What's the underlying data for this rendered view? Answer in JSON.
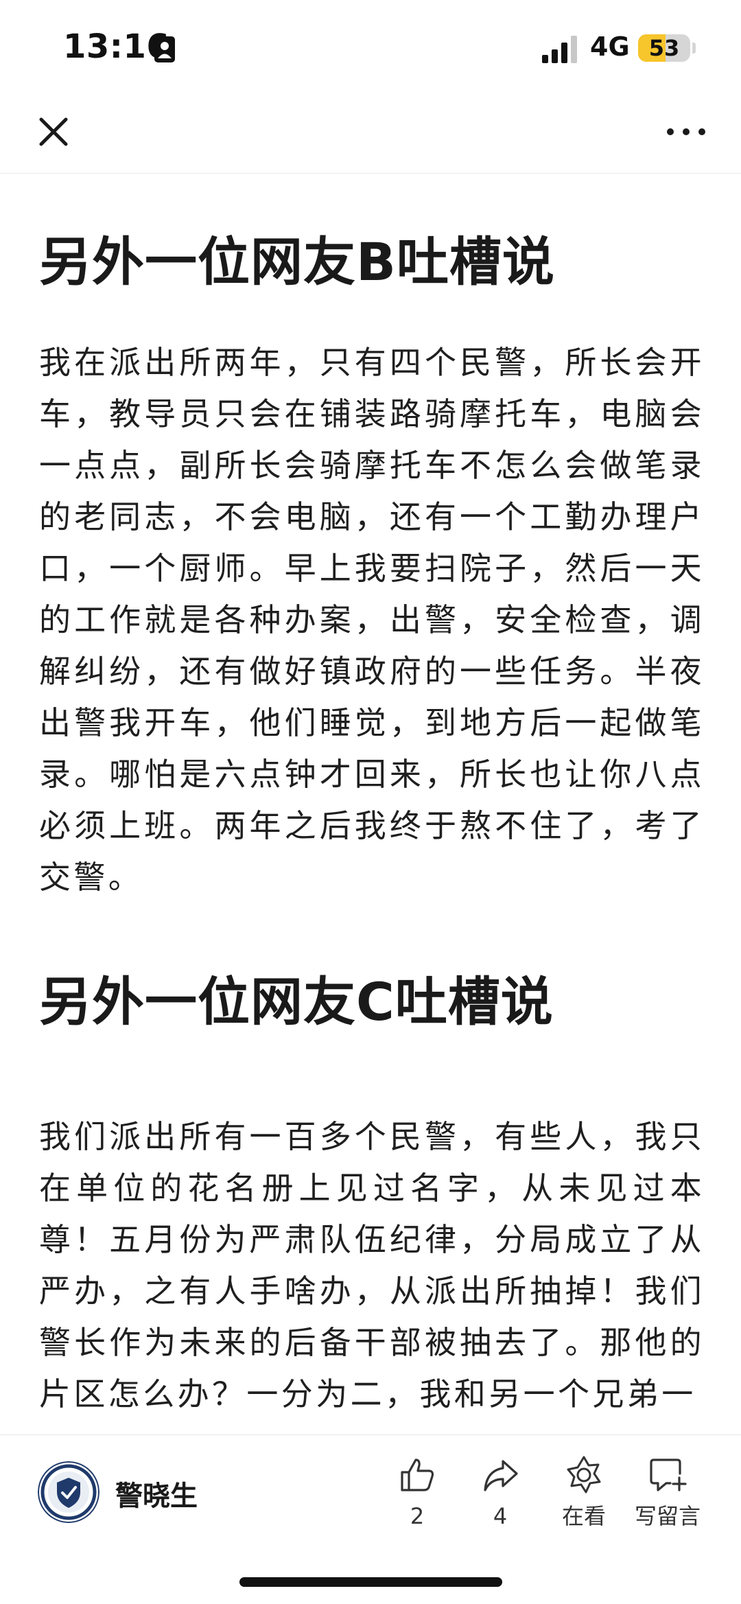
{
  "status_bar": {
    "time": "13:16",
    "network": "4G",
    "battery_percent": 53
  },
  "nav": {
    "close_icon": "close-icon",
    "more_icon": "more-icon"
  },
  "article": {
    "sections": [
      {
        "heading": "另外一位网友B吐槽说",
        "body": "我在派出所两年，只有四个民警，所长会开车，教导员只会在铺装路骑摩托车，电脑会一点点，副所长会骑摩托车不怎么会做笔录的老同志，不会电脑，还有一个工勤办理户口，一个厨师。早上我要扫院子，然后一天的工作就是各种办案，出警，安全检查，调解纠纷，还有做好镇政府的一些任务。半夜出警我开车，他们睡觉，到地方后一起做笔录。哪怕是六点钟才回来，所长也让你八点必须上班。两年之后我终于熬不住了，考了交警。"
      },
      {
        "heading": "另外一位网友C吐槽说",
        "body": "我们派出所有一百多个民警，有些人，我只在单位的花名册上见过名字，从未见过本尊！五月份为严肃队伍纪律，分局成立了从严办，之有人手啥办，从派出所抽掉！我们警长作为未来的后备干部被抽去了。那他的片区怎么办？一分为二，我和另一个兄弟一"
      }
    ]
  },
  "bottom_bar": {
    "author_name": "警晓生",
    "actions": {
      "like_count": "2",
      "share_count": "4",
      "wow_label": "在看",
      "comment_label": "写留言"
    }
  },
  "colors": {
    "text": "#1a1a1a",
    "battery_fill": "#f7c52c",
    "divider": "#ececec"
  }
}
